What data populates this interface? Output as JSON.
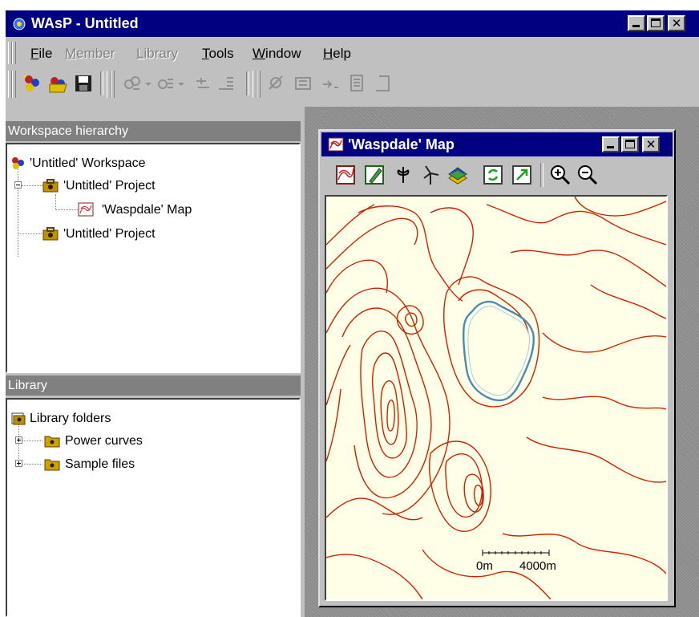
{
  "window": {
    "title": "WAsP - Untitled",
    "minimize": "_",
    "maximize": "□",
    "close": "✕"
  },
  "menu": [
    {
      "label": "File",
      "mnemonic": "F",
      "rest": "ile",
      "enabled": true
    },
    {
      "label": "Member",
      "mnemonic": "M",
      "rest": "ember",
      "enabled": false
    },
    {
      "label": "Library",
      "mnemonic": "L",
      "rest": "ibrary",
      "enabled": false
    },
    {
      "label": "Tools",
      "mnemonic": "T",
      "rest": "ools",
      "enabled": true
    },
    {
      "label": "Window",
      "mnemonic": "W",
      "rest": "indow",
      "enabled": true
    },
    {
      "label": "Help",
      "mnemonic": "H",
      "rest": "elp",
      "enabled": true
    }
  ],
  "toolbar_icons": [
    "new-workspace-icon",
    "open-workspace-icon",
    "save-icon",
    "add-member-icon",
    "insert-member-icon",
    "member-tool-icon",
    "member-list-icon",
    "library-add-icon",
    "library-open-icon",
    "library-insert-icon",
    "library-file-icon",
    "library-list-icon"
  ],
  "workspace_panel": {
    "title": "Workspace hierarchy",
    "items": [
      {
        "label": "'Untitled' Workspace"
      },
      {
        "label": "'Untitled' Project"
      },
      {
        "label": "'Waspdale' Map"
      },
      {
        "label": "'Untitled' Project"
      }
    ]
  },
  "library_panel": {
    "title": "Library",
    "items": [
      {
        "label": "Library folders"
      },
      {
        "label": "Power curves"
      },
      {
        "label": "Sample files"
      }
    ]
  },
  "map_window": {
    "title": "'Waspdale' Map",
    "toolbar_icons": [
      "map-edit-icon",
      "map-pen-icon",
      "map-site-icon",
      "turbine-icon",
      "layers-icon",
      "refresh-icon",
      "export-icon",
      "zoom-in-icon",
      "zoom-out-icon"
    ],
    "scale_start": "0m",
    "scale_end": "4000m"
  },
  "colors": {
    "title_bar": "#000080",
    "face": "#c0c0c0",
    "contour": "#cc2200",
    "lake": "#4a8cb0",
    "map_bg": "#ffffe8"
  }
}
